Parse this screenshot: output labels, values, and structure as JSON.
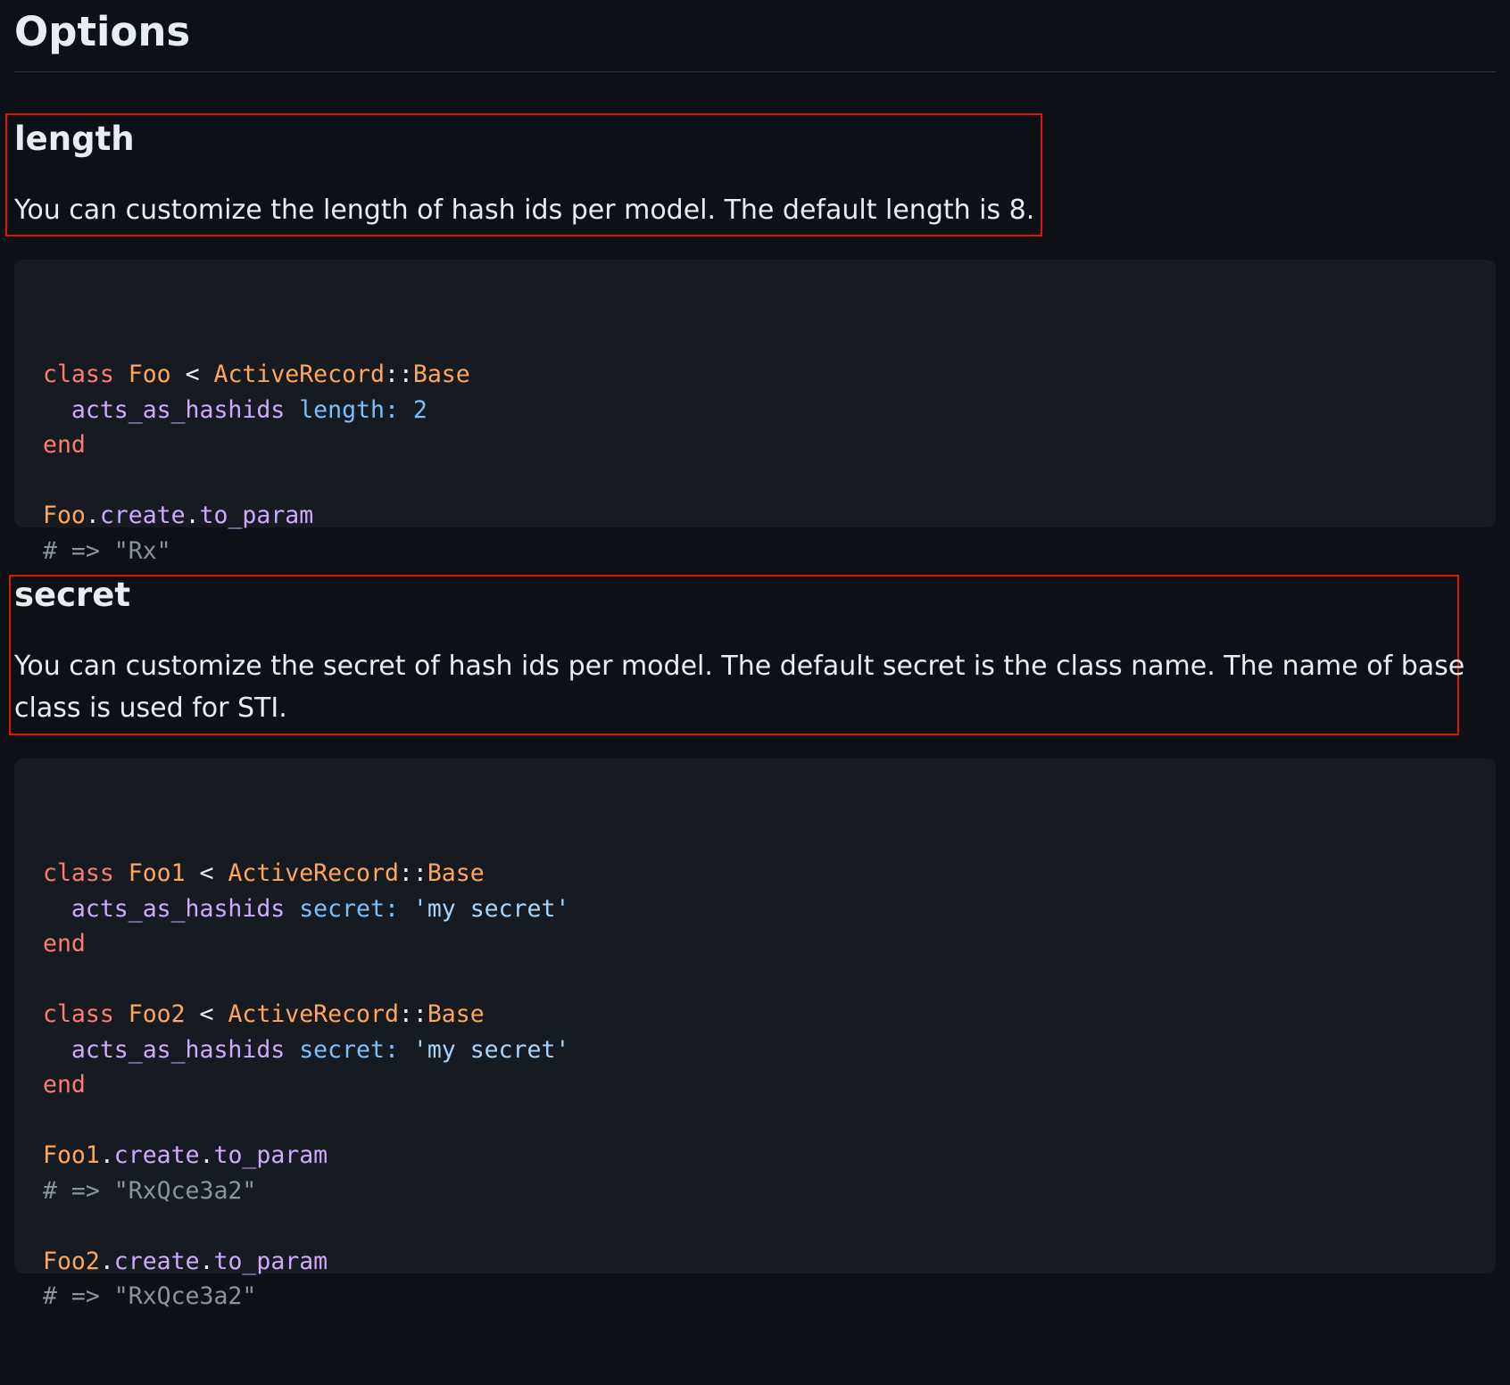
{
  "page_title": "Options",
  "sections": [
    {
      "title": "length",
      "description": "You can customize the length of hash ids per model. The default length is 8.",
      "code": [
        [
          [
            "kw",
            "class"
          ],
          [
            "pl",
            " "
          ],
          [
            "cls",
            "Foo"
          ],
          [
            "pl",
            " < "
          ],
          [
            "cls",
            "ActiveRecord"
          ],
          [
            "pl",
            "::"
          ],
          [
            "cls",
            "Base"
          ]
        ],
        [
          [
            "pl",
            "  "
          ],
          [
            "mt",
            "acts_as_hashids"
          ],
          [
            "pl",
            " "
          ],
          [
            "sym",
            "length:"
          ],
          [
            "pl",
            " "
          ],
          [
            "num",
            "2"
          ]
        ],
        [
          [
            "kw",
            "end"
          ]
        ],
        [],
        [
          [
            "cls",
            "Foo"
          ],
          [
            "pl",
            "."
          ],
          [
            "mt",
            "create"
          ],
          [
            "pl",
            "."
          ],
          [
            "mt",
            "to_param"
          ]
        ],
        [
          [
            "cm",
            "# => \"Rx\""
          ]
        ]
      ]
    },
    {
      "title": "secret",
      "description_line1": "You can customize the secret of hash ids per model. The default secret is the class name. The name of base",
      "description_line2": "class is used for STI.",
      "code": [
        [
          [
            "kw",
            "class"
          ],
          [
            "pl",
            " "
          ],
          [
            "cls",
            "Foo1"
          ],
          [
            "pl",
            " < "
          ],
          [
            "cls",
            "ActiveRecord"
          ],
          [
            "pl",
            "::"
          ],
          [
            "cls",
            "Base"
          ]
        ],
        [
          [
            "pl",
            "  "
          ],
          [
            "mt",
            "acts_as_hashids"
          ],
          [
            "pl",
            " "
          ],
          [
            "sym",
            "secret:"
          ],
          [
            "pl",
            " "
          ],
          [
            "str",
            "'my secret'"
          ]
        ],
        [
          [
            "kw",
            "end"
          ]
        ],
        [],
        [
          [
            "kw",
            "class"
          ],
          [
            "pl",
            " "
          ],
          [
            "cls",
            "Foo2"
          ],
          [
            "pl",
            " < "
          ],
          [
            "cls",
            "ActiveRecord"
          ],
          [
            "pl",
            "::"
          ],
          [
            "cls",
            "Base"
          ]
        ],
        [
          [
            "pl",
            "  "
          ],
          [
            "mt",
            "acts_as_hashids"
          ],
          [
            "pl",
            " "
          ],
          [
            "sym",
            "secret:"
          ],
          [
            "pl",
            " "
          ],
          [
            "str",
            "'my secret'"
          ]
        ],
        [
          [
            "kw",
            "end"
          ]
        ],
        [],
        [
          [
            "cls",
            "Foo1"
          ],
          [
            "pl",
            "."
          ],
          [
            "mt",
            "create"
          ],
          [
            "pl",
            "."
          ],
          [
            "mt",
            "to_param"
          ]
        ],
        [
          [
            "cm",
            "# => \"RxQce3a2\""
          ]
        ],
        [],
        [
          [
            "cls",
            "Foo2"
          ],
          [
            "pl",
            "."
          ],
          [
            "mt",
            "create"
          ],
          [
            "pl",
            "."
          ],
          [
            "mt",
            "to_param"
          ]
        ],
        [
          [
            "cm",
            "# => \"RxQce3a2\""
          ]
        ]
      ]
    }
  ],
  "colors": {
    "background": "#0d1117",
    "code_background": "#161b22",
    "highlight_border": "#e3120b",
    "keyword": "#ff7b72",
    "class_name": "#ffa657",
    "method": "#d2a8ff",
    "symbol": "#79c0ff",
    "string": "#a5d6ff",
    "comment": "#8b949e"
  }
}
